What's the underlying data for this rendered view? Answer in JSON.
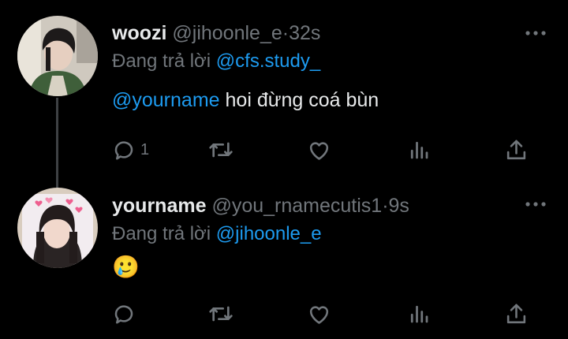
{
  "tweets": [
    {
      "name": "woozi",
      "handle": "@jihoonle_e",
      "time": "32s",
      "replying_prefix": "Đang trả lời",
      "replying_to": "@cfs.study_",
      "mention": "@yourname",
      "text": "hoi đừng coá bùn",
      "reply_count": "1"
    },
    {
      "name": "yourname",
      "handle": "@you_rnamecutis1",
      "time": "9s",
      "replying_prefix": "Đang trả lời",
      "replying_to": "@jihoonle_e",
      "emoji": "🥲",
      "reply_count": ""
    }
  ],
  "separator": "·",
  "icons": [
    "reply-icon",
    "retweet-icon",
    "like-icon",
    "views-icon",
    "share-icon",
    "more-icon"
  ],
  "colors": {
    "background": "#000000",
    "text": "#e7e9ea",
    "muted": "#71767b",
    "link": "#1d9bf0",
    "thread_line": "#3e4144"
  }
}
